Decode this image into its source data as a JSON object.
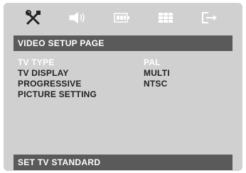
{
  "toolbar": {
    "icons": [
      {
        "name": "general-setup-icon"
      },
      {
        "name": "audio-setup-icon"
      },
      {
        "name": "video-setup-icon"
      },
      {
        "name": "preference-setup-icon"
      },
      {
        "name": "exit-setup-icon"
      }
    ]
  },
  "page": {
    "title": "VIDEO  SETUP  PAGE"
  },
  "menu": {
    "items": [
      {
        "label": "TV  TYPE",
        "selected": true
      },
      {
        "label": "TV  DISPLAY",
        "selected": false
      },
      {
        "label": "PROGRESSIVE",
        "selected": false
      },
      {
        "label": "PICTURE  SETTING",
        "selected": false
      }
    ],
    "options": [
      {
        "label": "PAL",
        "selected": true
      },
      {
        "label": "MULTI",
        "selected": false
      },
      {
        "label": "NTSC",
        "selected": false
      }
    ]
  },
  "status": {
    "text": "SET  TV  STANDARD"
  }
}
